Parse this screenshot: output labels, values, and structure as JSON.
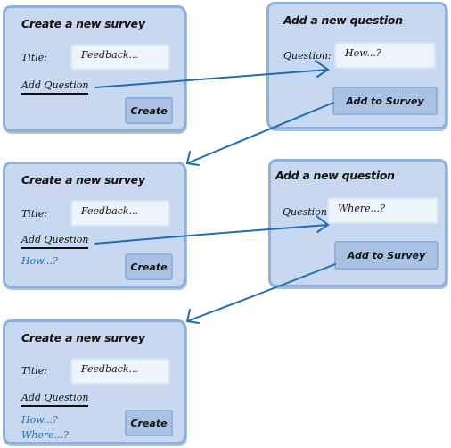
{
  "survey_form": {
    "title": "Create a new survey",
    "title_label": "Title:",
    "title_value": "Feedback...",
    "add_question_link": "Add Question",
    "create_button": "Create"
  },
  "question_form": {
    "title": "Add a new question",
    "question_label": "Question:",
    "add_button": "Add to Survey"
  },
  "steps": [
    {
      "survey_questions": [],
      "question_value": "How...?"
    },
    {
      "survey_questions": [
        "How...?"
      ],
      "question_value": "Where...?"
    },
    {
      "survey_questions": [
        "How...?",
        "Where...?"
      ]
    }
  ],
  "colors": {
    "panel": "#c7d8f0",
    "panel_border": "#8fb0da",
    "arrow": "#1f6eb0",
    "question_text": "#1f6eb0"
  }
}
